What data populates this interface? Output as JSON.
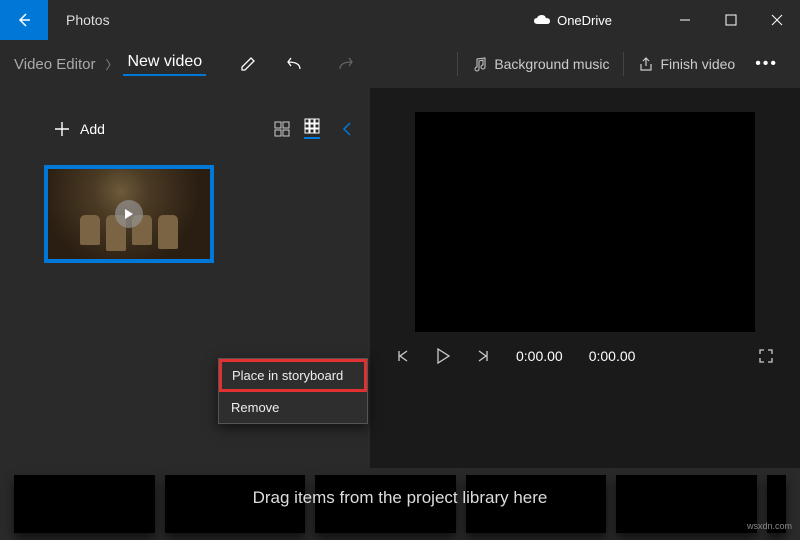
{
  "titlebar": {
    "app_name": "Photos",
    "cloud_label": "OneDrive"
  },
  "toolbar": {
    "breadcrumb_root": "Video Editor",
    "breadcrumb_current": "New video",
    "bg_music_label": "Background music",
    "finish_label": "Finish video"
  },
  "library": {
    "add_label": "Add"
  },
  "context_menu": {
    "place_label": "Place in storyboard",
    "remove_label": "Remove"
  },
  "playback": {
    "current_time": "0:00.00",
    "total_time": "0:00.00"
  },
  "storyboard": {
    "hint": "Drag items from the project library here"
  },
  "watermark": "wsxdn.com"
}
